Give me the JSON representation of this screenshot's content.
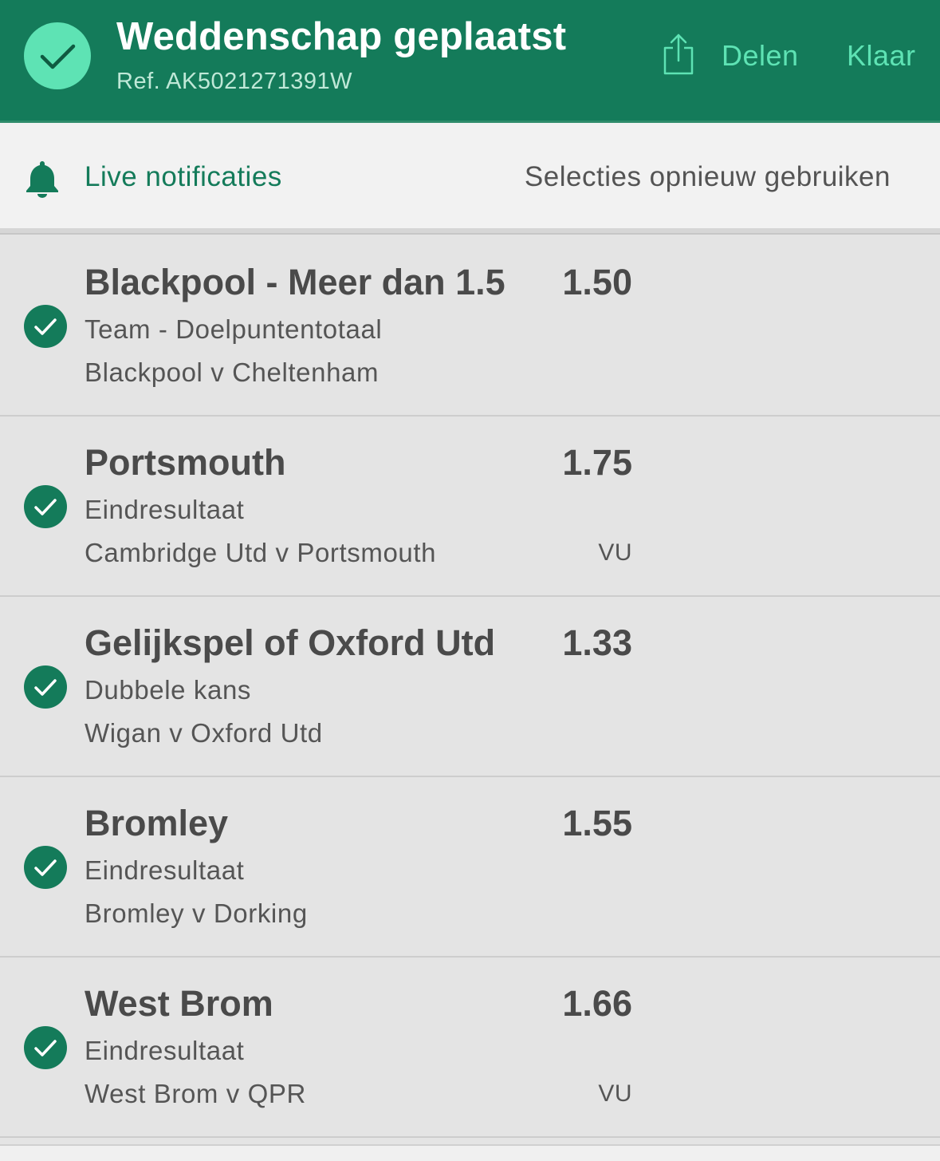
{
  "header": {
    "title": "Weddenschap geplaatst",
    "reference": "Ref. AK5021271391W",
    "share_label": "Delen",
    "done_label": "Klaar",
    "icons": [
      "check-icon",
      "share-icon"
    ],
    "colors": {
      "background": "#147b5a",
      "accent": "#5ee3b4"
    }
  },
  "notifications": {
    "live_label": "Live notificaties",
    "reuse_label": "Selecties opnieuw gebruiken",
    "icon": "bell-icon"
  },
  "selections": [
    {
      "name": "Blackpool - Meer dan 1.5",
      "odds": "1.50",
      "market": "Team - Doelpuntentotaal",
      "event": "Blackpool v Cheltenham",
      "status": ""
    },
    {
      "name": "Portsmouth",
      "odds": "1.75",
      "market": "Eindresultaat",
      "event": "Cambridge Utd v Portsmouth",
      "status": "VU"
    },
    {
      "name": "Gelijkspel of Oxford Utd",
      "odds": "1.33",
      "market": "Dubbele kans",
      "event": "Wigan v Oxford Utd",
      "status": ""
    },
    {
      "name": "Bromley",
      "odds": "1.55",
      "market": "Eindresultaat",
      "event": "Bromley v Dorking",
      "status": ""
    },
    {
      "name": "West Brom",
      "odds": "1.66",
      "market": "Eindresultaat",
      "event": "West Brom v QPR",
      "status": "VU"
    }
  ]
}
